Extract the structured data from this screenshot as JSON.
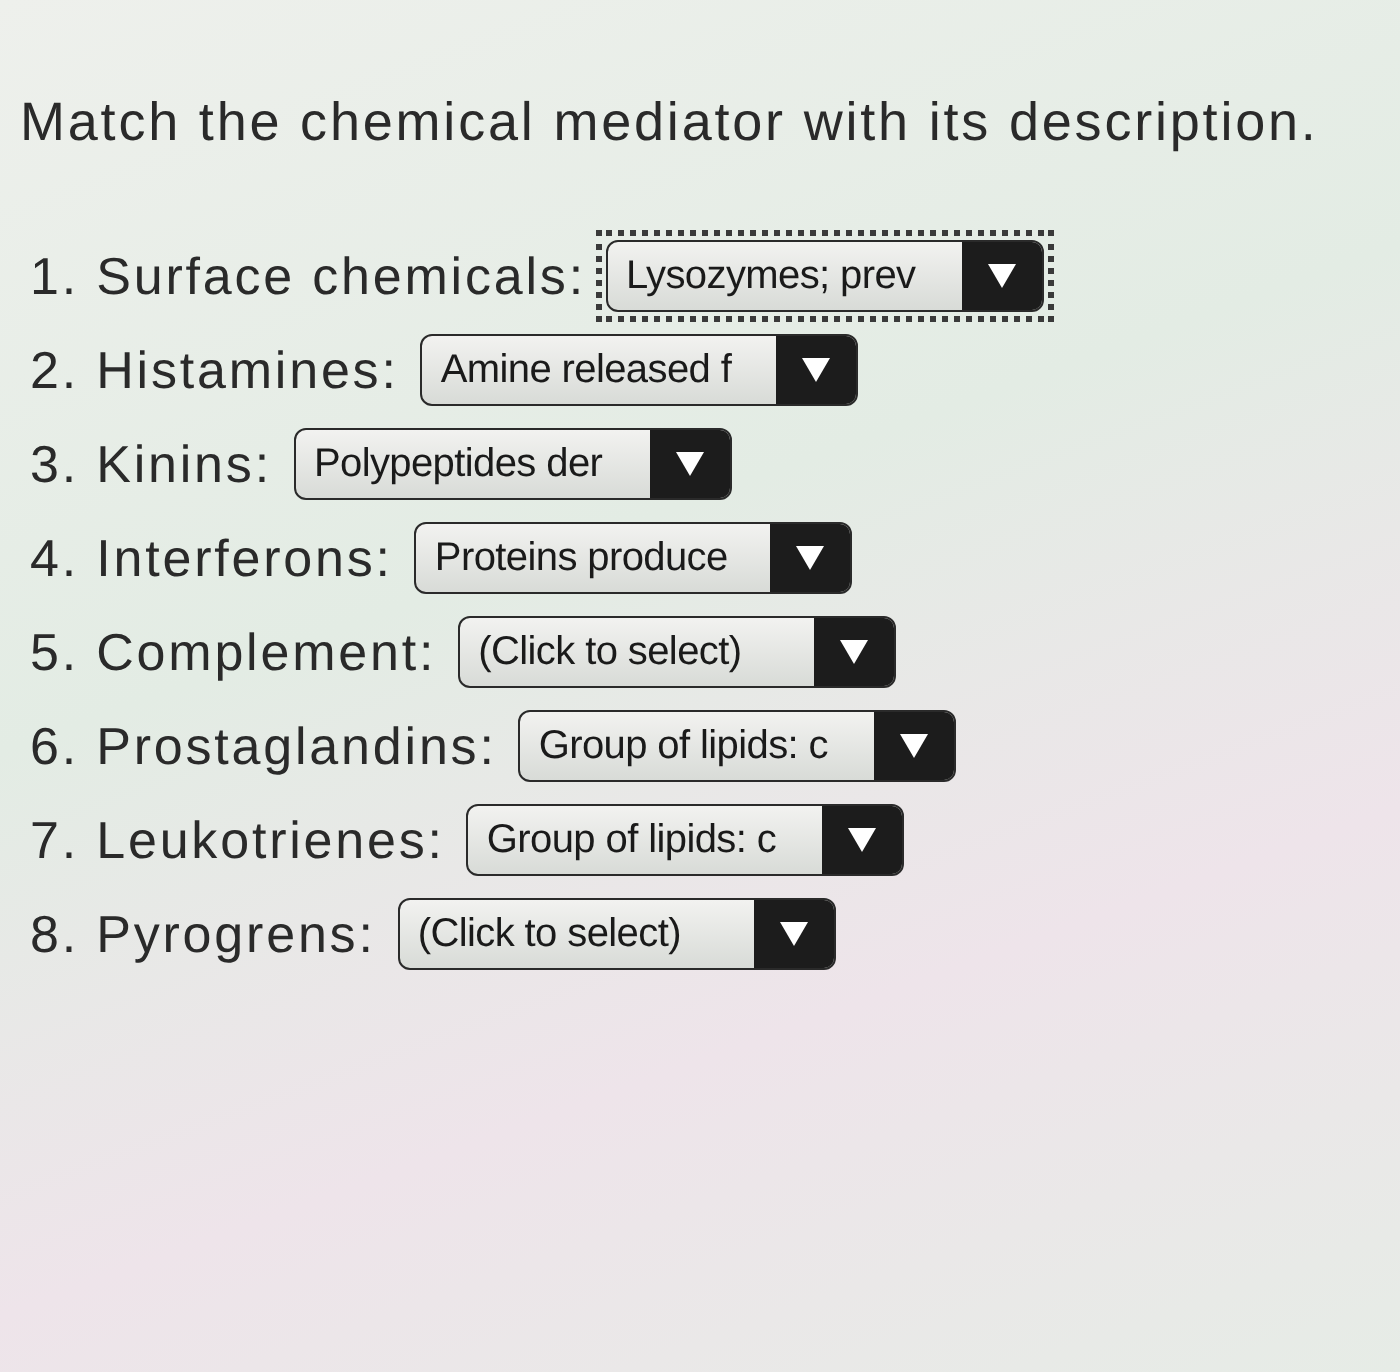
{
  "title": "Match the chemical mediator with its description.",
  "items": [
    {
      "label": "1. Surface chemicals:",
      "dropdown": {
        "value": "Lysozymes; prev",
        "focused": true
      }
    },
    {
      "label": "2. Histamines:",
      "dropdown": {
        "value": "Amine released f",
        "focused": false
      }
    },
    {
      "label": "3. Kinins:",
      "dropdown": {
        "value": "Polypeptides der",
        "focused": false
      }
    },
    {
      "label": "4. Interferons:",
      "dropdown": {
        "value": "Proteins produce",
        "focused": false
      }
    },
    {
      "label": "5. Complement:",
      "dropdown": {
        "value": "(Click to select)",
        "focused": false
      }
    },
    {
      "label": "6. Prostaglandins:",
      "dropdown": {
        "value": "Group of lipids: c",
        "focused": false
      }
    },
    {
      "label": "7. Leukotrienes:",
      "dropdown": {
        "value": "Group of lipids: c",
        "focused": false
      }
    },
    {
      "label": "8. Pyrogrens:",
      "dropdown": {
        "value": "(Click to select)",
        "focused": false
      }
    }
  ]
}
